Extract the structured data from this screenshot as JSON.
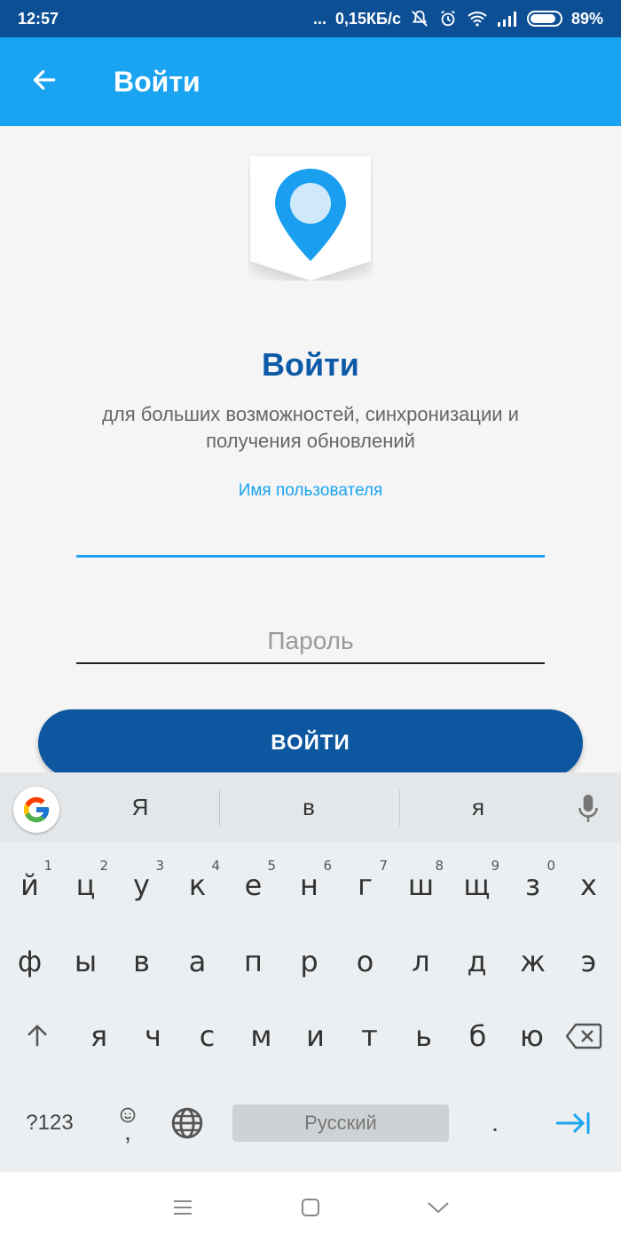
{
  "status_bar": {
    "time": "12:57",
    "dots": "...",
    "speed": "0,15КБ/с",
    "battery": "89%",
    "battery_level": 0.89
  },
  "app_bar": {
    "title": "Войти",
    "back_icon": "arrow-back-icon"
  },
  "login": {
    "logo_icon": "map-pin-icon",
    "heading": "Войти",
    "subtitle": "для больших возможностей, синхронизации и получения обновлений",
    "username_label": "Имя пользователя",
    "username_value": "",
    "password_placeholder": "Пароль",
    "password_value": "",
    "submit_label": "ВОЙТИ"
  },
  "keyboard": {
    "suggestions": [
      "Я",
      "в",
      "я"
    ],
    "row1": [
      {
        "k": "й",
        "h": "1"
      },
      {
        "k": "ц",
        "h": "2"
      },
      {
        "k": "у",
        "h": "3"
      },
      {
        "k": "к",
        "h": "4"
      },
      {
        "k": "е",
        "h": "5"
      },
      {
        "k": "н",
        "h": "6"
      },
      {
        "k": "г",
        "h": "7"
      },
      {
        "k": "ш",
        "h": "8"
      },
      {
        "k": "щ",
        "h": "9"
      },
      {
        "k": "з",
        "h": "0"
      },
      {
        "k": "х",
        "h": ""
      }
    ],
    "row2": [
      "ф",
      "ы",
      "в",
      "а",
      "п",
      "р",
      "о",
      "л",
      "д",
      "ж",
      "э"
    ],
    "row3": [
      "я",
      "ч",
      "с",
      "м",
      "и",
      "т",
      "ь",
      "б",
      "ю"
    ],
    "symbols_label": "?123",
    "emoji_comma": ",",
    "space_label": "Русский",
    "period": "."
  },
  "colors": {
    "status_bar": "#0d4f94",
    "app_bar": "#1aa3f0",
    "primary_dark": "#0d57a0",
    "accent": "#1aa3f0"
  }
}
